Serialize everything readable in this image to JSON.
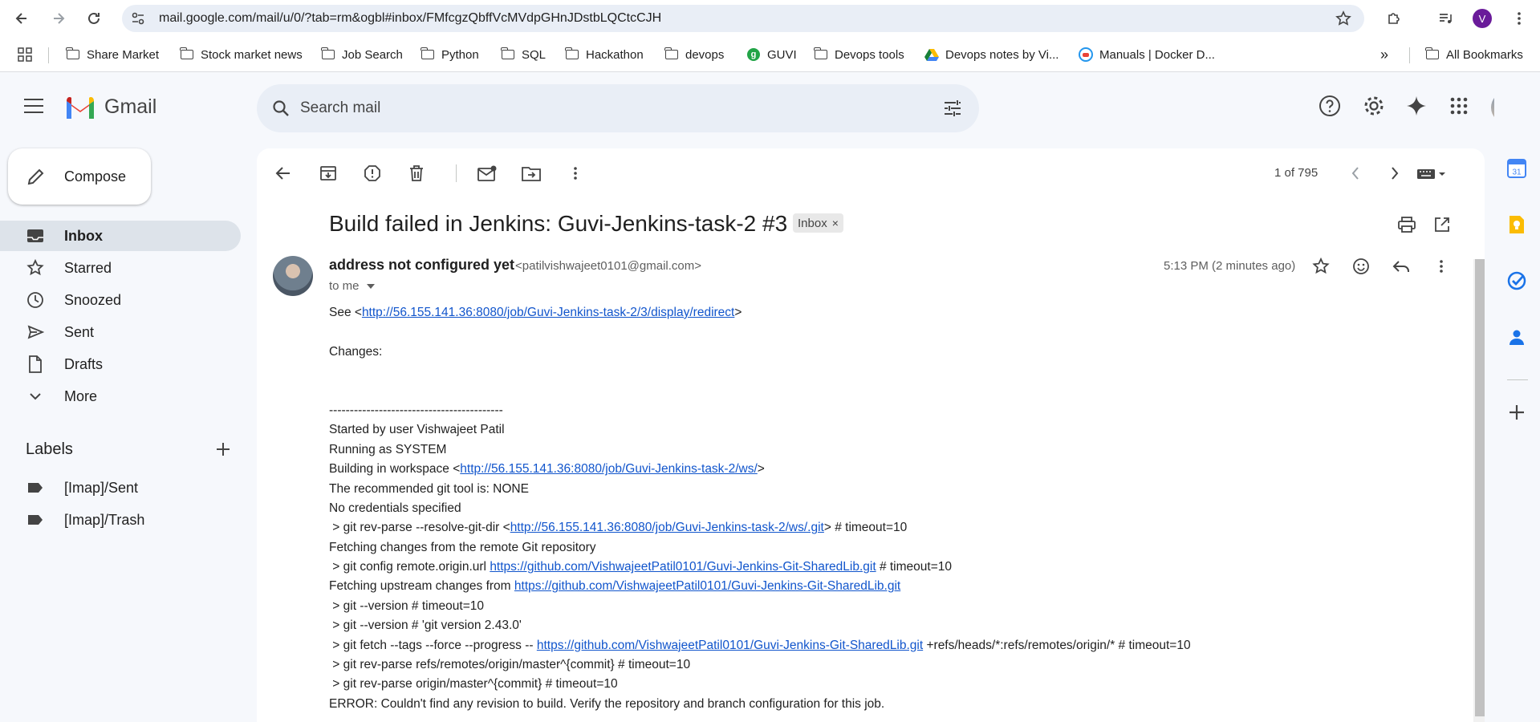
{
  "browser": {
    "url": "mail.google.com/mail/u/0/?tab=rm&ogbl#inbox/FMfcgzQbffVcMVdpGHnJDstbLQCtcCJH",
    "profile_initial": "V",
    "bookmarks": [
      {
        "label": "Share Market",
        "icon": "folder-icon"
      },
      {
        "label": "Stock market news",
        "icon": "folder-icon"
      },
      {
        "label": "Job Search",
        "icon": "folder-icon"
      },
      {
        "label": "Python",
        "icon": "folder-icon"
      },
      {
        "label": "SQL",
        "icon": "folder-icon"
      },
      {
        "label": "Hackathon",
        "icon": "folder-icon"
      },
      {
        "label": "devops",
        "icon": "folder-icon"
      },
      {
        "label": "GUVI",
        "icon": "guvi-icon"
      },
      {
        "label": "Devops tools",
        "icon": "folder-icon"
      },
      {
        "label": "Devops notes by Vi...",
        "icon": "drive-icon"
      },
      {
        "label": "Manuals | Docker D...",
        "icon": "docker-icon"
      }
    ],
    "more_bookmarks": "»",
    "all_bookmarks": "All Bookmarks"
  },
  "gmail": {
    "app_name": "Gmail",
    "search_placeholder": "Search mail",
    "compose": "Compose",
    "nav": [
      {
        "label": "Inbox",
        "icon": "inbox-icon",
        "active": true
      },
      {
        "label": "Starred",
        "icon": "star-icon"
      },
      {
        "label": "Snoozed",
        "icon": "clock-icon"
      },
      {
        "label": "Sent",
        "icon": "send-icon"
      },
      {
        "label": "Drafts",
        "icon": "draft-icon"
      },
      {
        "label": "More",
        "icon": "chevron-down-icon"
      }
    ],
    "labels_heading": "Labels",
    "labels": [
      "[Imap]/Sent",
      "[Imap]/Trash"
    ],
    "pager": "1 of 795"
  },
  "message": {
    "subject": "Build failed in Jenkins: Guvi-Jenkins-task-2 #3",
    "label_badge": "Inbox",
    "from_name": "address not configured yet",
    "from_email": "<patilvishwajeet0101@gmail.com>",
    "to": "to me",
    "time": "5:13 PM (2 minutes ago)",
    "body": [
      {
        "pre": "See <",
        "link": "http://56.155.141.36:8080/job/Guvi-Jenkins-task-2/3/display/redirect",
        "post": ">"
      },
      {
        "pre": "",
        "link": "",
        "post": ""
      },
      {
        "pre": "Changes:",
        "link": "",
        "post": ""
      },
      {
        "pre": "",
        "link": "",
        "post": ""
      },
      {
        "pre": "",
        "link": "",
        "post": ""
      },
      {
        "pre": "------------------------------------------",
        "link": "",
        "post": ""
      },
      {
        "pre": "Started by user Vishwajeet Patil",
        "link": "",
        "post": ""
      },
      {
        "pre": "Running as SYSTEM",
        "link": "",
        "post": ""
      },
      {
        "pre": "Building in workspace <",
        "link": "http://56.155.141.36:8080/job/Guvi-Jenkins-task-2/ws/",
        "post": ">"
      },
      {
        "pre": "The recommended git tool is: NONE",
        "link": "",
        "post": ""
      },
      {
        "pre": "No credentials specified",
        "link": "",
        "post": ""
      },
      {
        "pre": " > git rev-parse --resolve-git-dir <",
        "link": "http://56.155.141.36:8080/job/Guvi-Jenkins-task-2/ws/.git",
        "post": "> # timeout=10"
      },
      {
        "pre": "Fetching changes from the remote Git repository",
        "link": "",
        "post": ""
      },
      {
        "pre": " > git config remote.origin.url ",
        "link": "https://github.com/VishwajeetPatil0101/Guvi-Jenkins-Git-SharedLib.git",
        "post": " # timeout=10"
      },
      {
        "pre": "Fetching upstream changes from ",
        "link": "https://github.com/VishwajeetPatil0101/Guvi-Jenkins-Git-SharedLib.git",
        "post": ""
      },
      {
        "pre": " > git --version # timeout=10",
        "link": "",
        "post": ""
      },
      {
        "pre": " > git --version # 'git version 2.43.0'",
        "link": "",
        "post": ""
      },
      {
        "pre": " > git fetch --tags --force --progress -- ",
        "link": "https://github.com/VishwajeetPatil0101/Guvi-Jenkins-Git-SharedLib.git",
        "post": " +refs/heads/*:refs/remotes/origin/* # timeout=10"
      },
      {
        "pre": " > git rev-parse refs/remotes/origin/master^{commit} # timeout=10",
        "link": "",
        "post": ""
      },
      {
        "pre": " > git rev-parse origin/master^{commit} # timeout=10",
        "link": "",
        "post": ""
      },
      {
        "pre": "ERROR: Couldn't find any revision to build. Verify the repository and branch configuration for this job.",
        "link": "",
        "post": ""
      }
    ]
  },
  "side_panel": {
    "calendar_day": "31"
  },
  "colors": {
    "link": "#1155cc",
    "active_nav": "#dde3ea",
    "search_bg": "#e9eef6"
  }
}
